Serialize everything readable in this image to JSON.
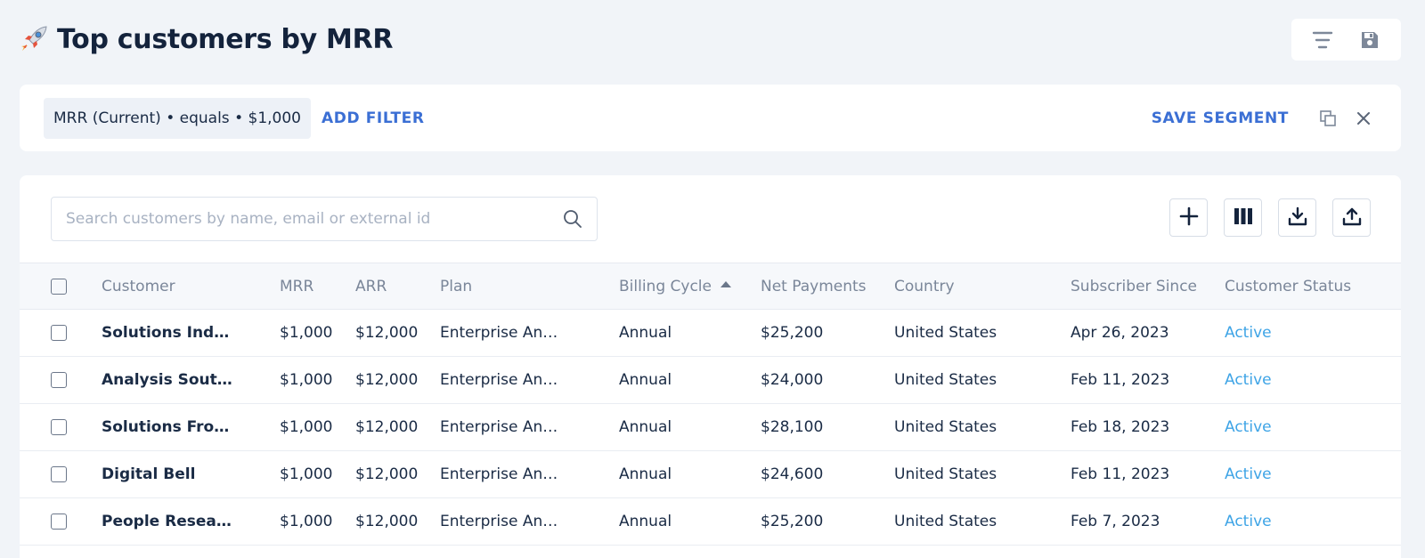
{
  "header": {
    "icon": "rocket-icon",
    "title": "Top customers by MRR",
    "actions": [
      {
        "name": "filter-lines-icon"
      },
      {
        "name": "save-disk-icon"
      }
    ]
  },
  "filter_bar": {
    "chip_label": "MRR (Current) • equals • $1,000",
    "add_filter_label": "ADD FILTER",
    "save_segment_label": "SAVE SEGMENT",
    "icons": [
      "copy-icon",
      "close-icon"
    ]
  },
  "toolbar": {
    "search_placeholder": "Search customers by name, email or external id",
    "search_value": "",
    "tools": [
      "plus-icon",
      "columns-icon",
      "download-icon",
      "upload-icon"
    ]
  },
  "table": {
    "columns": [
      "Customer",
      "MRR",
      "ARR",
      "Plan",
      "Billing Cycle",
      "Net Payments",
      "Country",
      "Subscriber Since",
      "Customer Status"
    ],
    "sorted_column": "Billing Cycle",
    "sort_direction": "ascending",
    "rows": [
      {
        "customer": "Solutions Ind…",
        "mrr": "$1,000",
        "arr": "$12,000",
        "plan": "Enterprise An…",
        "billing": "Annual",
        "net": "$25,200",
        "country": "United States",
        "since": "Apr 26, 2023",
        "status": "Active"
      },
      {
        "customer": "Analysis Sout…",
        "mrr": "$1,000",
        "arr": "$12,000",
        "plan": "Enterprise An…",
        "billing": "Annual",
        "net": "$24,000",
        "country": "United States",
        "since": "Feb 11, 2023",
        "status": "Active"
      },
      {
        "customer": "Solutions Fro…",
        "mrr": "$1,000",
        "arr": "$12,000",
        "plan": "Enterprise An…",
        "billing": "Annual",
        "net": "$28,100",
        "country": "United States",
        "since": "Feb 18, 2023",
        "status": "Active"
      },
      {
        "customer": "Digital Bell",
        "mrr": "$1,000",
        "arr": "$12,000",
        "plan": "Enterprise An…",
        "billing": "Annual",
        "net": "$24,600",
        "country": "United States",
        "since": "Feb 11, 2023",
        "status": "Active"
      },
      {
        "customer": "People Resea…",
        "mrr": "$1,000",
        "arr": "$12,000",
        "plan": "Enterprise An…",
        "billing": "Annual",
        "net": "$25,200",
        "country": "United States",
        "since": "Feb 7, 2023",
        "status": "Active"
      }
    ]
  },
  "colors": {
    "accent": "#3b6fd4",
    "status_active": "#3ea4e6",
    "background": "#f1f4f8"
  }
}
